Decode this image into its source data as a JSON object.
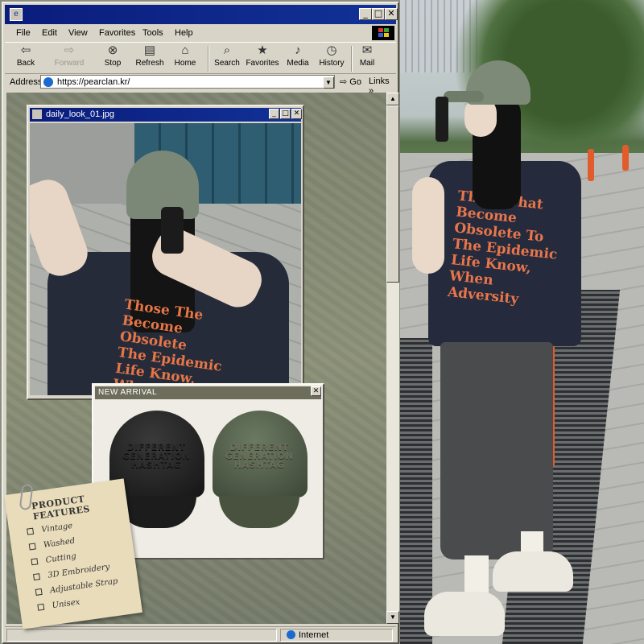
{
  "browser": {
    "menu": [
      "File",
      "Edit",
      "View",
      "Favorites",
      "Tools",
      "Help"
    ],
    "toolbar": {
      "back": "Back",
      "forward": "Forward",
      "stop": "Stop",
      "refresh": "Refresh",
      "home": "Home",
      "search": "Search",
      "favorites": "Favorites",
      "media": "Media",
      "history": "History",
      "mail": "Mail"
    },
    "address_label": "Address",
    "url": "https://pearclan.kr/",
    "go": "Go",
    "links": "Links",
    "status_zone": "Internet"
  },
  "photo_window": {
    "title": "daily_look_01.jpg",
    "shirt_print": [
      "Those The",
      "Become",
      "Obsolete",
      "The Epidemic",
      "Life Know,",
      "When"
    ]
  },
  "new_arrival": {
    "title": "NEW ARRIVAL",
    "embroidery": [
      "DIFFERENT",
      "GENERATION",
      "HASHTAG"
    ]
  },
  "features": {
    "heading": "PRODUCT FEATURES",
    "items": [
      "Vintage",
      "Washed",
      "Cutting",
      "3D Embroidery",
      "Adjustable Strap",
      "Unisex"
    ]
  },
  "street_photo": {
    "shirt_print": [
      "Those That",
      "Become",
      "Obsolete To",
      "The Epidemic",
      "Life Know,",
      "When",
      "Adversity"
    ]
  },
  "colors": {
    "titlebar": "#0a1c7c",
    "chrome": "#d8d4c8",
    "print_orange": "#e8764b"
  }
}
